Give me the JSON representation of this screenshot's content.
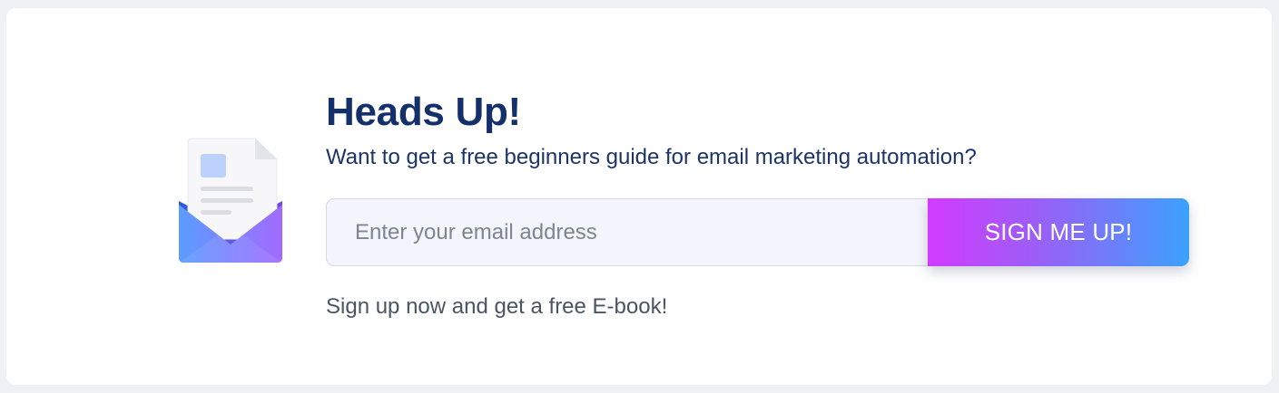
{
  "colors": {
    "title": "#14306b",
    "subtitle": "#1c3468",
    "note": "#4a5563",
    "button_gradient_start": "#d23bff",
    "button_gradient_end": "#3ca1fd",
    "input_background": "#f4f5fc"
  },
  "icon": {
    "name": "envelope-document-icon"
  },
  "heading": {
    "title": "Heads Up!",
    "subtitle": "Want to get a free beginners guide for email marketing automation?"
  },
  "form": {
    "email_placeholder": "Enter your email address",
    "email_value": "",
    "submit_label": "SIGN ME UP!"
  },
  "note": "Sign up now and get a free E-book!"
}
